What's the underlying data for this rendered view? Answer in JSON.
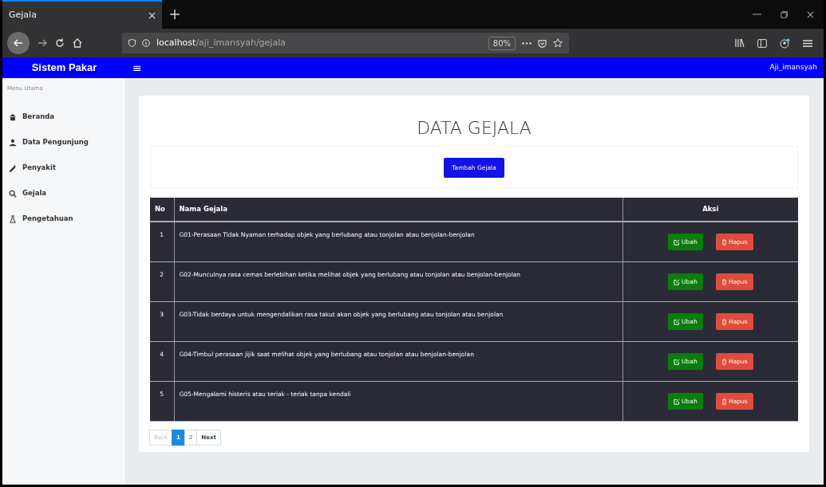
{
  "browser": {
    "tab_title": "Gejala",
    "url_host": "localhost",
    "url_path": "/aji_imansyah/gejala",
    "zoom": "80%"
  },
  "navbar": {
    "brand": "Sistem Pakar",
    "menu_glyph": "≡",
    "user": "Aji_imansyah"
  },
  "sidebar": {
    "heading": "Menu Utama",
    "items": [
      {
        "label": "Beranda",
        "kind": "home"
      },
      {
        "label": "Data Pengunjung",
        "kind": "user"
      },
      {
        "label": "Penyakit",
        "kind": "pipette"
      },
      {
        "label": "Gejala",
        "kind": "search"
      },
      {
        "label": "Pengetahuan",
        "kind": "flask"
      }
    ]
  },
  "page": {
    "title": "DATA GEJALA",
    "add_button": "Tambah Gejala"
  },
  "table": {
    "columns": [
      "No",
      "Nama Gejala",
      "Aksi"
    ],
    "rows": [
      {
        "no": "1",
        "name": "G01-Perasaan Tidak Nyaman terhadap objek yang berlubang atau tonjolan atau benjolan-benjolan",
        "edit": "Ubah",
        "delete": "Hapus"
      },
      {
        "no": "2",
        "name": "G02-Munculnya rasa cemas berlebihan ketika melihat objek yang berlubang atau tonjolan atau benjolan-benjolan",
        "edit": "Ubah",
        "delete": "Hapus"
      },
      {
        "no": "3",
        "name": "G03-Tidak berdaya untuk mengendalikan rasa takut akan objek yang berlubang atau tonjolan atau benjolan",
        "edit": "Ubah",
        "delete": "Hapus"
      },
      {
        "no": "4",
        "name": "G04-Timbul perasaan jijik saat melihat objek yang berlubang atau tonjolan atau benjolan-benjolan",
        "edit": "Ubah",
        "delete": "Hapus"
      },
      {
        "no": "5",
        "name": "G05-Mengalami histeris atau teriak - teriak tanpa kendali",
        "edit": "Ubah",
        "delete": "Hapus"
      }
    ]
  },
  "pagination": [
    {
      "label": "Back",
      "selected": false,
      "disabled": true
    },
    {
      "label": "1",
      "selected": true,
      "disabled": false
    },
    {
      "label": "2",
      "selected": false,
      "disabled": false
    },
    {
      "label": "Next",
      "selected": false,
      "disabled": false
    }
  ]
}
